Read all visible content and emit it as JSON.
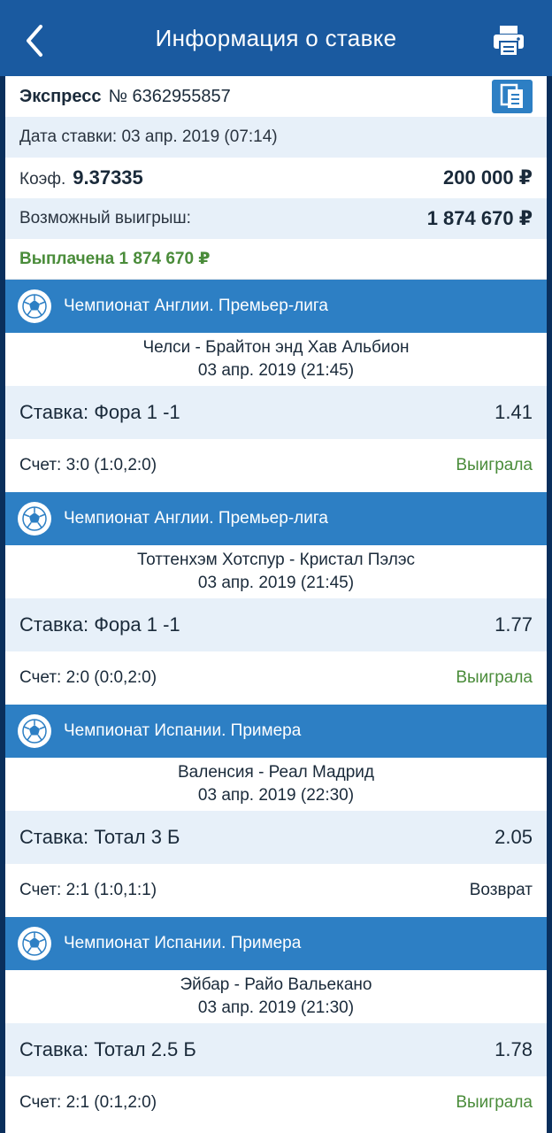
{
  "header": {
    "title": "Информация о ставке",
    "back_icon": "chevron-left-icon",
    "print_icon": "printer-icon"
  },
  "bet": {
    "type": "Экспресс",
    "number": "№ 6362955857",
    "date": "Дата ставки: 03 апр. 2019 (07:14)",
    "coef_label": "Коэф.",
    "coef_value": "9.37335",
    "stake": "200 000 ₽",
    "win_label": "Возможный выигрыш:",
    "win_value": "1 874 670 ₽",
    "paid": "Выплачена 1 874 670 ₽"
  },
  "colors": {
    "header": "#1a5aa0",
    "accent": "#2d7fc4",
    "light_row": "#e7f0f9",
    "won": "#4a8c3a",
    "neutral": "#1a2a3a"
  },
  "events": [
    {
      "league": "Чемпионат Англии. Премьер-лига",
      "teams": "Челси - Брайтон энд Хав Альбион",
      "date": "03 апр. 2019 (21:45)",
      "bet": "Ставка: Фора 1 -1",
      "coef": "1.41",
      "score": "Счет: 3:0 (1:0,2:0)",
      "result": "Выиграла",
      "result_color": "#4a8c3a"
    },
    {
      "league": "Чемпионат Англии. Премьер-лига",
      "teams": "Тоттенхэм Хотспур - Кристал Пэлэс",
      "date": "03 апр. 2019 (21:45)",
      "bet": "Ставка: Фора 1 -1",
      "coef": "1.77",
      "score": "Счет: 2:0 (0:0,2:0)",
      "result": "Выиграла",
      "result_color": "#4a8c3a"
    },
    {
      "league": "Чемпионат Испании. Примера",
      "teams": "Валенсия - Реал Мадрид",
      "date": "03 апр. 2019 (22:30)",
      "bet": "Ставка: Тотал 3 Б",
      "coef": "2.05",
      "score": "Счет: 2:1 (1:0,1:1)",
      "result": "Возврат",
      "result_color": "#1a2a3a"
    },
    {
      "league": "Чемпионат Испании. Примера",
      "teams": "Эйбар - Райо Вальекано",
      "date": "03 апр. 2019 (21:30)",
      "bet": "Ставка: Тотал 2.5 Б",
      "coef": "1.78",
      "score": "Счет: 2:1 (0:1,2:0)",
      "result": "Выиграла",
      "result_color": "#4a8c3a"
    }
  ]
}
